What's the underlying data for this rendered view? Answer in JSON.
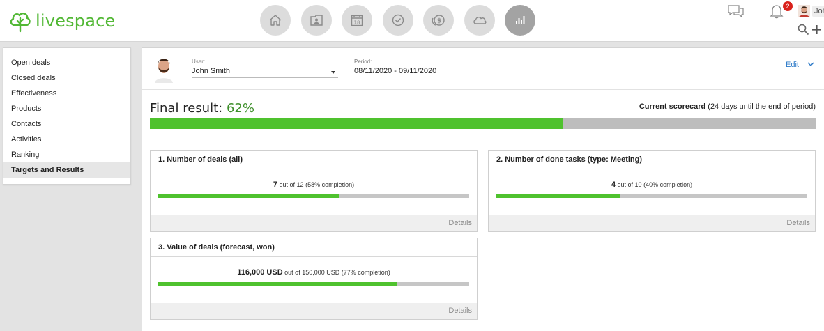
{
  "header": {
    "logo_text": "livespace",
    "nav": [
      {
        "icon": "home-icon"
      },
      {
        "icon": "contacts-folder-icon"
      },
      {
        "icon": "calendar-icon",
        "text": "18"
      },
      {
        "icon": "task-check-icon"
      },
      {
        "icon": "deals-money-icon"
      },
      {
        "icon": "cloud-icon"
      },
      {
        "icon": "bar-chart-icon",
        "active": true
      }
    ],
    "notifications_count": "2",
    "user_name": "John"
  },
  "sidebar": {
    "items": [
      {
        "label": "Open deals"
      },
      {
        "label": "Closed deals"
      },
      {
        "label": "Effectiveness"
      },
      {
        "label": "Products"
      },
      {
        "label": "Contacts"
      },
      {
        "label": "Activities"
      },
      {
        "label": "Ranking"
      },
      {
        "label": "Targets and Results",
        "active": true
      }
    ]
  },
  "topbar": {
    "user_label": "User:",
    "user_value": "John Smith",
    "period_label": "Period:",
    "period_value": "08/11/2020 - 09/11/2020",
    "edit_label": "Edit"
  },
  "summary": {
    "final_label": "Final result:",
    "final_value": "62%",
    "progress": 0.62,
    "scorecard_bold": "Current scorecard",
    "scorecard_note": "(24 days until the end of period)"
  },
  "cards": [
    {
      "title": "1. Number of deals (all)",
      "value": "7",
      "target": "out of 12",
      "completion": "(58% completion)",
      "progress": 0.58,
      "details": "Details"
    },
    {
      "title": "2. Number of done tasks (type: Meeting)",
      "value": "4",
      "target": "out of 10",
      "completion": "(40% completion)",
      "progress": 0.4,
      "details": "Details"
    },
    {
      "title": "3. Value of deals (forecast, won)",
      "value": "116,000 USD",
      "target": "out of 150,000 USD",
      "completion": "(77% completion)",
      "progress": 0.77,
      "details": "Details"
    }
  ],
  "colors": {
    "brand_green": "#52b835",
    "progress_green": "#4fc22e",
    "result_green": "#3e8f2b",
    "link_blue": "#2a78c7",
    "badge_red": "#d9221c"
  }
}
